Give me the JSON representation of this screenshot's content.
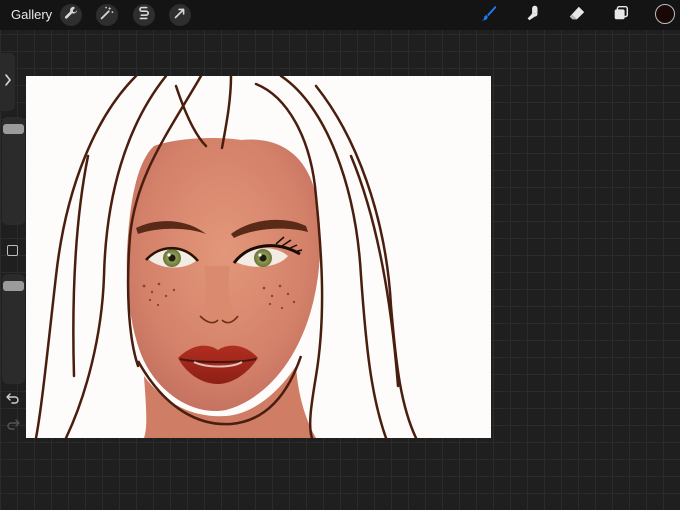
{
  "app": {
    "gallery_label": "Gallery"
  },
  "toolbar": {
    "left_tools": [
      "wrench-icon",
      "magic-wand-icon",
      "selection-icon",
      "transform-icon"
    ],
    "right_tools": [
      "brush-icon",
      "smudge-icon",
      "eraser-icon",
      "layers-icon"
    ],
    "active_tool": "brush-icon",
    "accent_color": "#1e7cf2",
    "current_color": "#1a0806"
  },
  "sidebar": {
    "brush_size_level": 0.03,
    "opacity_level": 0.03
  },
  "colors": {
    "skin": "#d9876a",
    "lips": "#a4261b",
    "iris": "#8c9a4f",
    "outline": "#4a1e0e"
  }
}
